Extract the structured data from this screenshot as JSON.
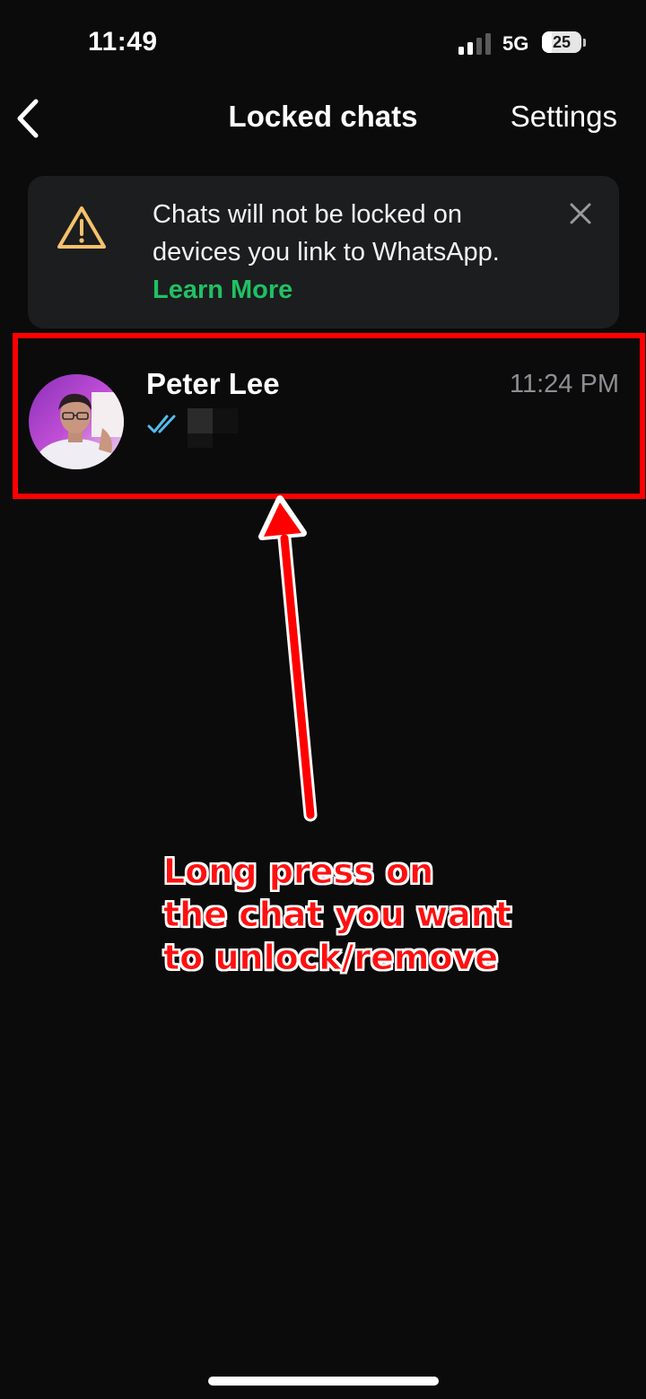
{
  "status_bar": {
    "time": "11:49",
    "network": "5G",
    "battery": "25",
    "battery_percent": 25
  },
  "nav": {
    "title": "Locked chats",
    "settings_label": "Settings"
  },
  "banner": {
    "line1": "Chats will not be locked on",
    "line2": "devices you link to WhatsApp.",
    "link": "Learn More",
    "icon": "warning-triangle-icon",
    "close_icon": "close-icon"
  },
  "chat": {
    "name": "Peter Lee",
    "time": "11:24 PM",
    "receipt_icon": "double-check-icon"
  },
  "annotation": {
    "line1": "Long press on",
    "line2": "the chat you want",
    "line3": "to unlock/remove"
  },
  "colors": {
    "background": "#0b0b0c",
    "accent_green": "#21c063",
    "annotation_red": "#ff0000",
    "read_receipt_blue": "#53bdeb",
    "warning_yellow": "#f5c26b"
  }
}
